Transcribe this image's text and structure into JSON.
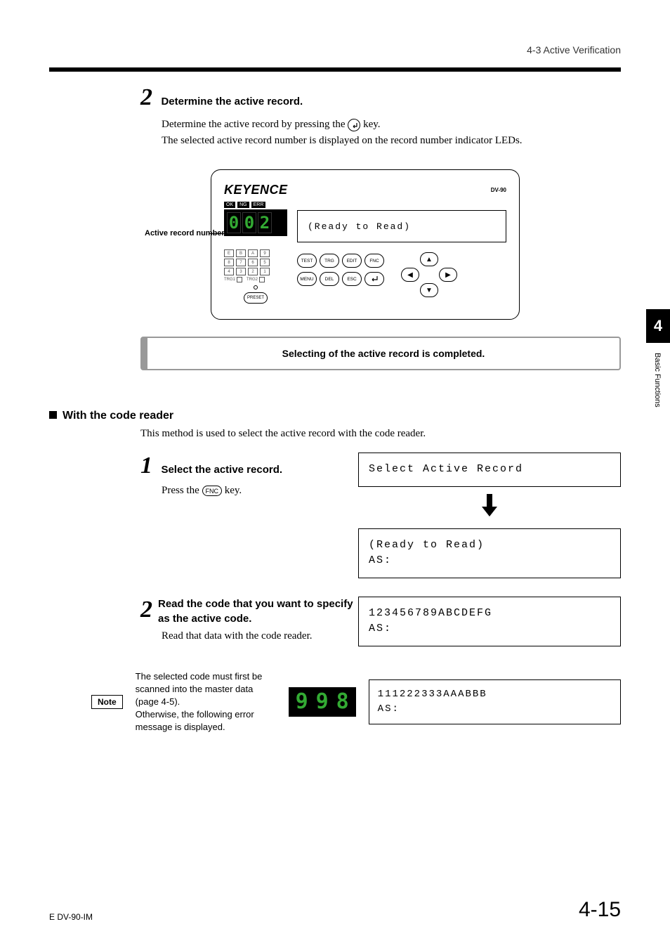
{
  "header": {
    "breadcrumb": "4-3  Active Verification"
  },
  "sideTab": {
    "chapter": "4",
    "label": "Basic Functions"
  },
  "step2a": {
    "num": "2",
    "title": "Determine the active record.",
    "line1_pre": "Determine the active record by pressing the ",
    "line1_post": " key.",
    "line2": "The selected active record number is displayed on the record number indicator LEDs."
  },
  "device": {
    "brand": "KEYENCE",
    "model": "DV-90",
    "status": [
      "OK",
      "NG",
      "ERR"
    ],
    "seg": [
      "0",
      "0",
      "2"
    ],
    "lcd": "(Ready to Read)",
    "pointerLabel": "Active record number",
    "ledRows": [
      [
        "E",
        "B",
        "A",
        "9"
      ],
      [
        "8",
        "7",
        "6",
        "5"
      ],
      [
        "4",
        "3",
        "2",
        "1"
      ]
    ],
    "trg": [
      "TRG1",
      "TRG2"
    ],
    "preset": "PRESET",
    "btns1": [
      "TEST",
      "TRG",
      "EDIT",
      "FNC"
    ],
    "btns2": [
      "MENU",
      "DEL",
      "ESC",
      "↵"
    ]
  },
  "completion": "Selecting of the active record is completed.",
  "section2": {
    "title": "With the code reader",
    "intro": "This method is used to select the active record with the code reader."
  },
  "step1b": {
    "num": "1",
    "title": "Select the active record.",
    "body_pre": "Press the ",
    "fnc": "FNC",
    "body_post": " key.",
    "lcd1": "Select Active Record",
    "lcd2a": "(Ready to Read)",
    "lcd2b": "AS:"
  },
  "step2b": {
    "num": "2",
    "title": "Read the code that you want to specify as the active code.",
    "body": "Read that data with the code reader.",
    "lcd_a": "123456789ABCDEFG",
    "lcd_b": "AS:"
  },
  "note": {
    "label": "Note",
    "text": "The selected code must first be scanned into the master data (page 4-5).\nOtherwise, the following error message is displayed.",
    "seg": [
      "9",
      "9",
      "8"
    ],
    "lcd_a": "111222333AAABBB",
    "lcd_b": "AS:"
  },
  "footer": {
    "left": "E DV-90-IM",
    "right": "4-15"
  }
}
